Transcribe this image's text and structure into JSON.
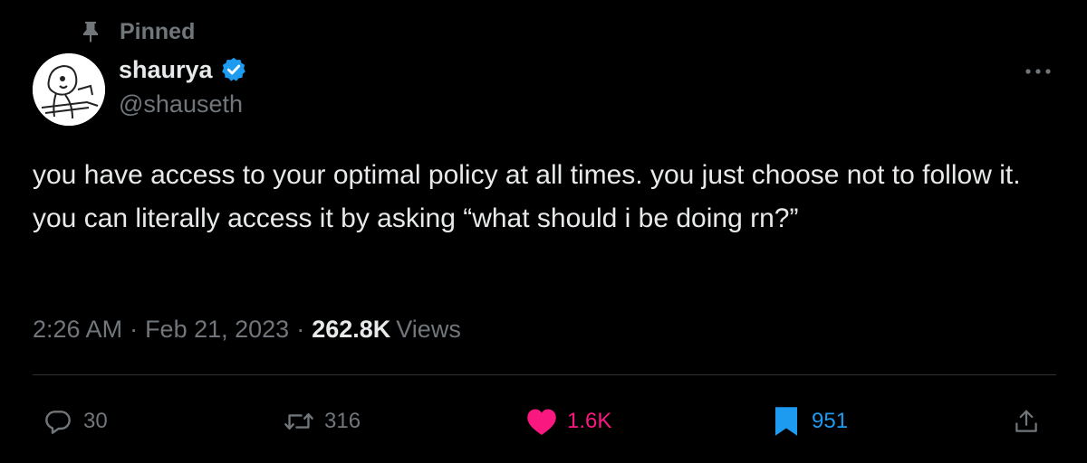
{
  "pinned": {
    "label": "Pinned",
    "icon": "pin-icon"
  },
  "author": {
    "display_name": "shaurya",
    "handle": "@shauseth",
    "verified_icon": "verified-badge-icon",
    "verified_color": "#1d9bf0"
  },
  "tweet": {
    "text": "you have access to your optimal policy at all times. you just choose not to follow it. you can literally access it by asking “what should i be doing rn?”"
  },
  "meta": {
    "time": "2:26 AM",
    "separator": "·",
    "date": "Feb 21, 2023",
    "views_count": "262.8K",
    "views_label": "Views"
  },
  "actions": {
    "reply": {
      "count": "30",
      "icon": "reply-icon"
    },
    "retweet": {
      "count": "316",
      "icon": "retweet-icon"
    },
    "like": {
      "count": "1.6K",
      "icon": "heart-icon",
      "color": "#f91880"
    },
    "bookmark": {
      "count": "951",
      "icon": "bookmark-icon",
      "color": "#1d9bf0"
    },
    "share": {
      "icon": "share-icon"
    }
  },
  "colors": {
    "background": "#000000",
    "text_primary": "#e7e9ea",
    "text_secondary": "#71767b",
    "divider": "#2f3336"
  }
}
